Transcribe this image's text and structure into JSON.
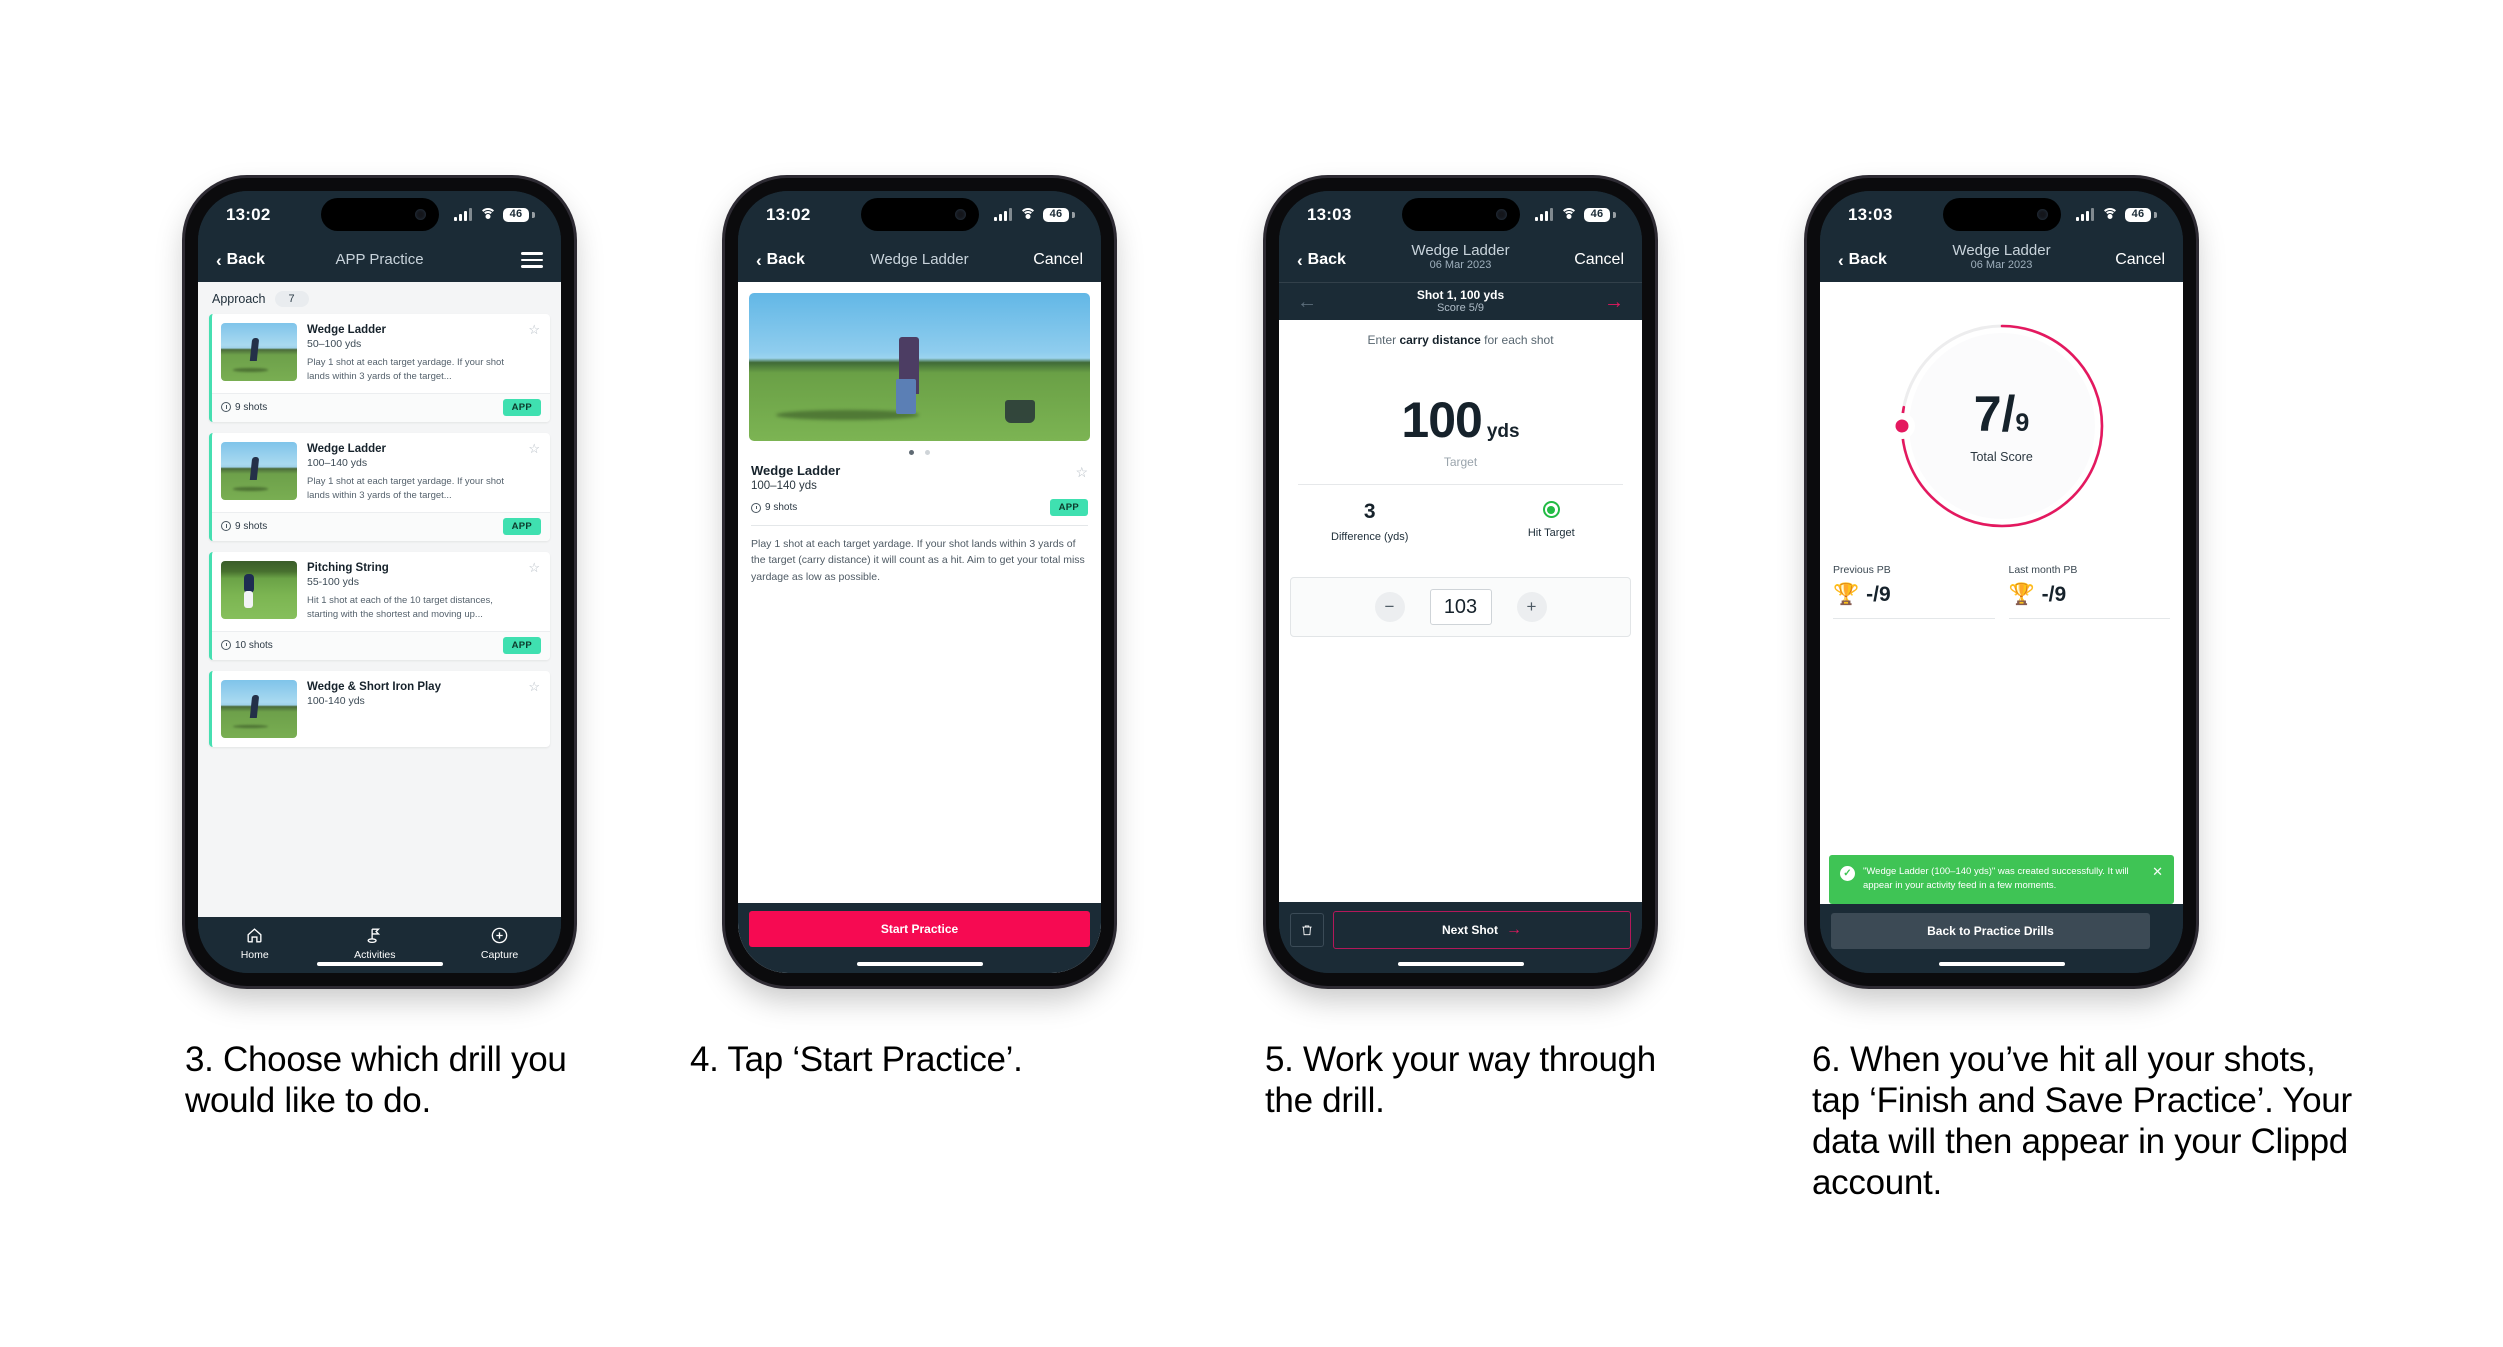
{
  "phones": [
    {
      "id": "phone-1",
      "status": {
        "time": "13:02",
        "battery": "46"
      },
      "nav": {
        "back": "Back",
        "title": "APP Practice"
      },
      "section": {
        "label": "Approach",
        "count": "7"
      },
      "cards": [
        {
          "title": "Wedge Ladder",
          "yardage": "50–100 yds",
          "desc": "Play 1 shot at each target yardage. If your shot lands within 3 yards of the target...",
          "shots": "9 shots",
          "tag": "APP"
        },
        {
          "title": "Wedge Ladder",
          "yardage": "100–140 yds",
          "desc": "Play 1 shot at each target yardage. If your shot lands within 3 yards of the target...",
          "shots": "9 shots",
          "tag": "APP"
        },
        {
          "title": "Pitching String",
          "yardage": "55-100 yds",
          "desc": "Hit 1 shot at each of the 10 target distances, starting with the shortest and moving up...",
          "shots": "10 shots",
          "tag": "APP"
        },
        {
          "title": "Wedge & Short Iron Play",
          "yardage": "100-140 yds",
          "desc": "",
          "shots": "",
          "tag": ""
        }
      ],
      "tabs": [
        {
          "label": "Home",
          "icon": "home-icon"
        },
        {
          "label": "Activities",
          "icon": "golf-flag-icon"
        },
        {
          "label": "Capture",
          "icon": "plus-circle-icon"
        }
      ]
    },
    {
      "id": "phone-2",
      "status": {
        "time": "13:02",
        "battery": "46"
      },
      "nav": {
        "back": "Back",
        "title": "Wedge Ladder",
        "cancel": "Cancel"
      },
      "detail": {
        "title": "Wedge Ladder",
        "yardage": "100–140 yds",
        "shots": "9 shots",
        "tag": "APP",
        "description": "Play 1 shot at each target yardage. If your shot lands within 3 yards of the target (carry distance) it will count as a hit. Aim to get your total miss yardage as low as possible."
      },
      "cta": "Start Practice"
    },
    {
      "id": "phone-3",
      "status": {
        "time": "13:03",
        "battery": "46"
      },
      "nav": {
        "back": "Back",
        "title": "Wedge Ladder",
        "subtitle": "06 Mar 2023",
        "cancel": "Cancel"
      },
      "subnav": {
        "shot": "Shot 1, 100 yds",
        "score": "Score 5/9"
      },
      "prompt_pre": "Enter ",
      "prompt_bold": "carry distance",
      "prompt_post": " for each shot",
      "target": {
        "value": "100",
        "unit": "yds",
        "label": "Target"
      },
      "stats": [
        {
          "value": "3",
          "label": "Difference (yds)"
        },
        {
          "value": "",
          "label": "Hit Target"
        }
      ],
      "stepper": {
        "minus": "−",
        "value": "103",
        "plus": "+"
      },
      "footer": {
        "next": "Next Shot",
        "arrow": "→"
      }
    },
    {
      "id": "phone-4",
      "status": {
        "time": "13:03",
        "battery": "46"
      },
      "nav": {
        "back": "Back",
        "title": "Wedge Ladder",
        "subtitle": "06 Mar 2023",
        "cancel": "Cancel"
      },
      "ring": {
        "score": "7",
        "separator": "/",
        "total": "9",
        "label": "Total Score",
        "progress_pct": 78,
        "color": "#e4185f"
      },
      "pbs": [
        {
          "label": "Previous PB",
          "value": "-/9"
        },
        {
          "label": "Last month PB",
          "value": "-/9"
        }
      ],
      "toast": {
        "message": "\"Wedge Ladder (100–140 yds)\" was created successfully. It will appear in your activity feed in a few moments.",
        "color": "#3fc455"
      },
      "cta": "Back to Practice Drills"
    }
  ],
  "captions": [
    "3. Choose which drill you would like to do.",
    "4. Tap ‘Start Practice’.",
    "5. Work your way through the drill.",
    "6. When you’ve hit all your shots, tap ‘Finish and Save Practice’. Your data will then appear in your Clippd account."
  ],
  "colors": {
    "header": "#1b2b36",
    "accent_pink": "#f60a52",
    "accent_teal": "#3fe0b0",
    "success_green": "#3fc455",
    "ring_pink": "#e4185f"
  }
}
